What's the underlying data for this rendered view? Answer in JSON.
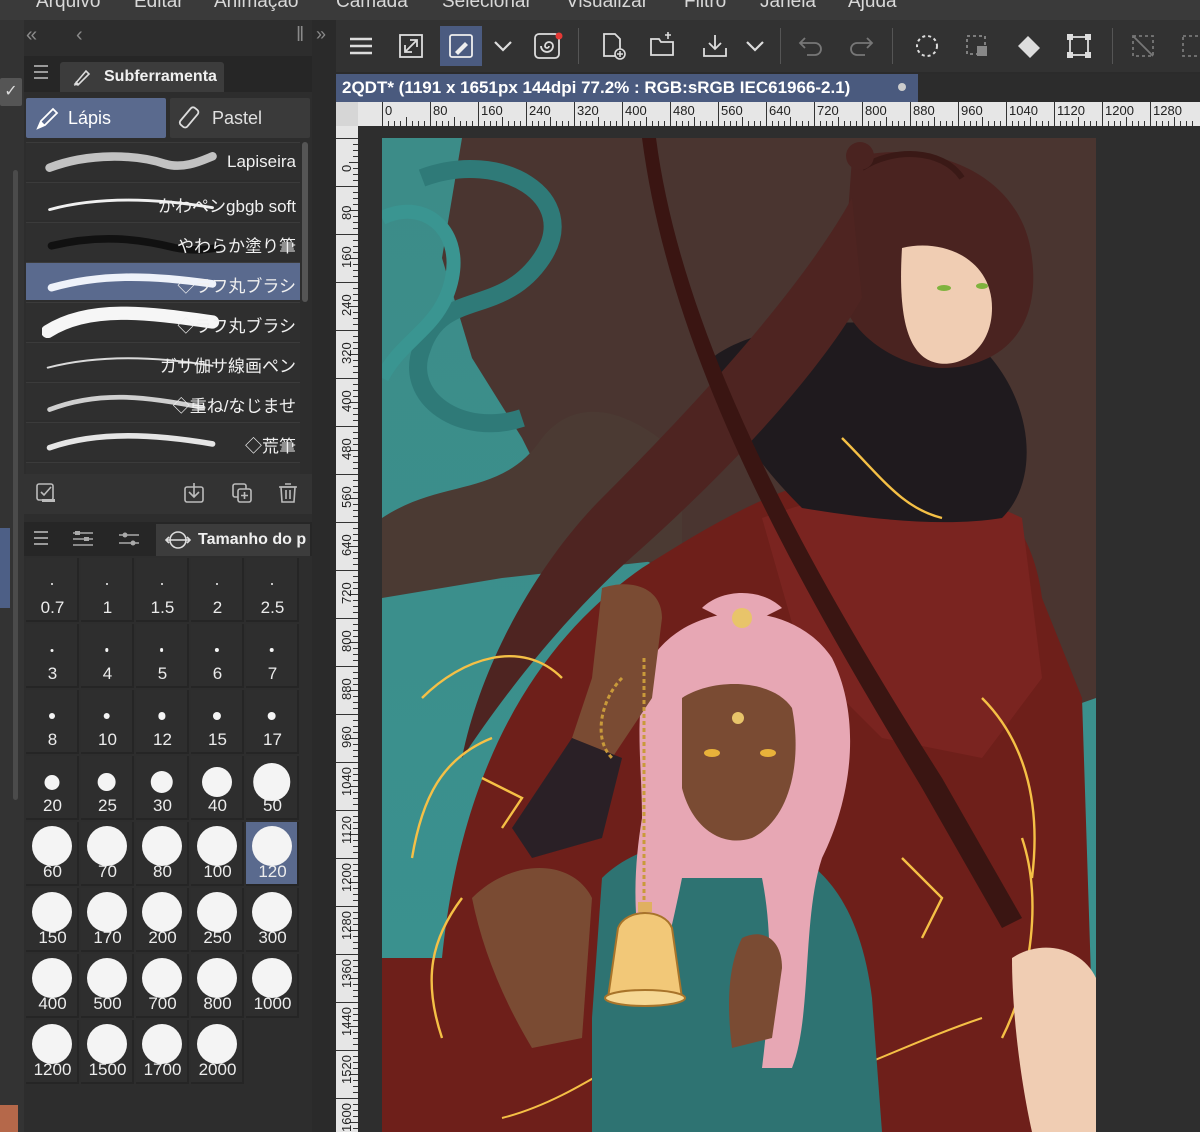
{
  "menu": [
    "Arquivo",
    "Editar",
    "Animação",
    "Camada",
    "Selecionar",
    "Visualizar",
    "Filtro",
    "Janela",
    "Ajuda"
  ],
  "subtool_panel": {
    "title": "Subferramenta",
    "groups": [
      {
        "label": "Lápis",
        "selected": true
      },
      {
        "label": "Pastel",
        "selected": false
      }
    ],
    "brushes": [
      {
        "name": "Lapiseira",
        "selected": false
      },
      {
        "name": "かわペンgbgb soft",
        "selected": false
      },
      {
        "name": "やわらか塗り筆",
        "selected": false
      },
      {
        "name": "◇ラフ丸ブラシ",
        "selected": true
      },
      {
        "name": "◇ラフ丸ブラシ",
        "selected": false
      },
      {
        "name": "ガサ伽サ線画ペン",
        "selected": false
      },
      {
        "name": "◇重ね/なじませ",
        "selected": false
      },
      {
        "name": "◇荒筆",
        "selected": false
      }
    ]
  },
  "brush_size_panel": {
    "title": "Tamanho do p",
    "sizes": [
      "0.7",
      "1",
      "1.5",
      "2",
      "2.5",
      "3",
      "4",
      "5",
      "6",
      "7",
      "8",
      "10",
      "12",
      "15",
      "17",
      "20",
      "25",
      "30",
      "40",
      "50",
      "60",
      "70",
      "80",
      "100",
      "120",
      "150",
      "170",
      "200",
      "250",
      "300",
      "400",
      "500",
      "700",
      "800",
      "1000",
      "1200",
      "1500",
      "1700",
      "2000"
    ],
    "selected": "120"
  },
  "canvas": {
    "tab_title": "2QDT* (1191 x 1651px 144dpi 77.2% : RGB:sRGB IEC61966-2.1)",
    "h_ruler": [
      "0",
      "80",
      "160",
      "240",
      "320",
      "400",
      "480",
      "560",
      "640",
      "720",
      "800",
      "880",
      "960",
      "1040",
      "1120",
      "1200",
      "1280"
    ],
    "v_ruler": [
      "0",
      "80",
      "160",
      "240",
      "320",
      "400",
      "480",
      "560",
      "640",
      "720",
      "800",
      "880",
      "960",
      "1040",
      "1120",
      "1200",
      "1280",
      "1360",
      "1440",
      "1520",
      "1600"
    ]
  },
  "colors": {
    "accent": "#5a6a8e",
    "tab_accent": "#4a5a7e",
    "panel_bg": "#2d2d2d",
    "ruler_bg": "#e6e6e6"
  }
}
